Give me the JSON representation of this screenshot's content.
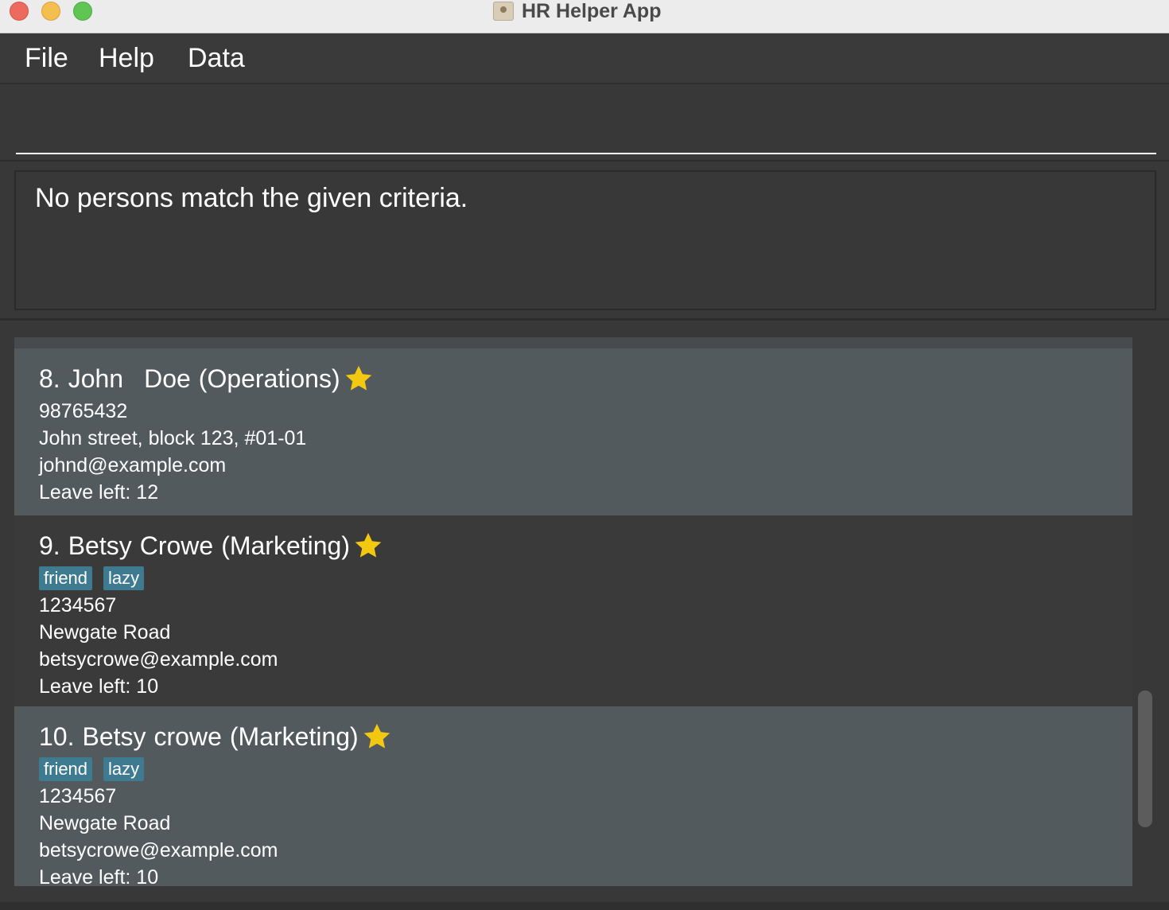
{
  "window": {
    "title": "HR Helper App"
  },
  "menu": [
    {
      "label": "File"
    },
    {
      "label": "Help"
    },
    {
      "label": "Data"
    }
  ],
  "command": {
    "value": "",
    "placeholder": ""
  },
  "result": {
    "message": "No persons match the given criteria."
  },
  "persons": [
    {
      "index": "8.",
      "first": "John",
      "last": "Doe",
      "department": "(Operations)",
      "favourite": true,
      "tags": [],
      "phone": "98765432",
      "address": "John street, block 123, #01-01",
      "email": "johnd@example.com",
      "leave": "Leave left: 12"
    },
    {
      "index": "9.",
      "first": "Betsy",
      "last": "Crowe",
      "department": "(Marketing)",
      "favourite": true,
      "tags": [
        "friend",
        "lazy"
      ],
      "phone": "1234567",
      "address": "Newgate Road",
      "email": "betsycrowe@example.com",
      "leave": "Leave left: 10"
    },
    {
      "index": "10.",
      "first": "Betsy",
      "last": "crowe",
      "department": "(Marketing)",
      "favourite": true,
      "tags": [
        "friend",
        "lazy"
      ],
      "phone": "1234567",
      "address": "Newgate Road",
      "email": "betsycrowe@example.com",
      "leave": "Leave left: 10"
    }
  ],
  "colors": {
    "star": "#f2c811",
    "tag": "#3e7b91",
    "card_even": "#535a5e",
    "card_odd": "#3a3a3a"
  },
  "icons": {
    "favourite": "star-icon",
    "app": "contacts-app-icon"
  }
}
